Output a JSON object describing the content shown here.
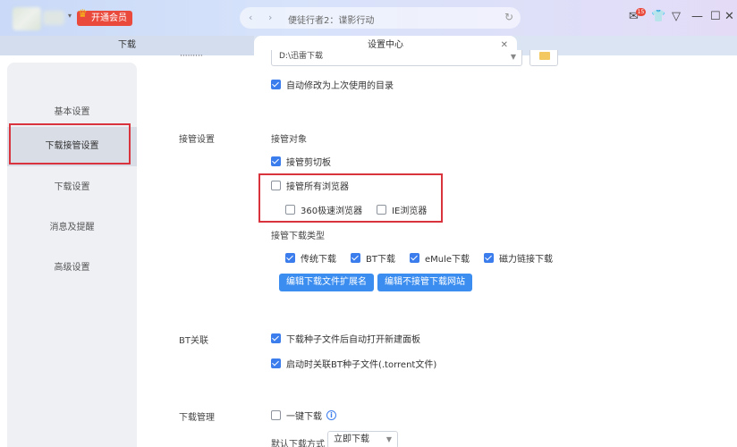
{
  "titlebar": {
    "vip_label": "开通会员",
    "address_title": "便徒行者2：谍影行动",
    "notif_count": "15"
  },
  "tabs": [
    {
      "label": "下载"
    },
    {
      "label": "设置中心"
    }
  ],
  "sidebar": {
    "items": [
      {
        "label": "基本设置"
      },
      {
        "label": "下载接管设置"
      },
      {
        "label": "下载设置"
      },
      {
        "label": "消息及提醒"
      },
      {
        "label": "高级设置"
      }
    ]
  },
  "download_dir": {
    "path": "D:\\迅雷下载",
    "auto_change_label": "自动修改为上次使用的目录"
  },
  "takeover": {
    "section_label": "接管设置",
    "target_label": "接管对象",
    "clipboard_label": "接管剪切板",
    "all_browsers_label": "接管所有浏览器",
    "browser_360_label": "360极速浏览器",
    "browser_ie_label": "IE浏览器",
    "type_label": "接管下载类型",
    "types": [
      {
        "label": "传统下载"
      },
      {
        "label": "BT下载"
      },
      {
        "label": "eMule下载"
      },
      {
        "label": "磁力链接下载"
      }
    ],
    "edit_ext_button": "编辑下载文件扩展名",
    "edit_sites_button": "编辑不接管下载网站"
  },
  "bt": {
    "section_label": "BT关联",
    "open_panel_label": "下载种子文件后自动打开新建面板",
    "associate_label": "启动时关联BT种子文件(.torrent文件)"
  },
  "manage": {
    "section_label": "下载管理",
    "one_click_label": "一键下载",
    "default_mode_label": "默认下载方式",
    "default_mode_value": "立即下载"
  },
  "colors": {
    "accent": "#3b7ded",
    "highlight_box": "#d9343d",
    "vip": "#e94a3c"
  }
}
